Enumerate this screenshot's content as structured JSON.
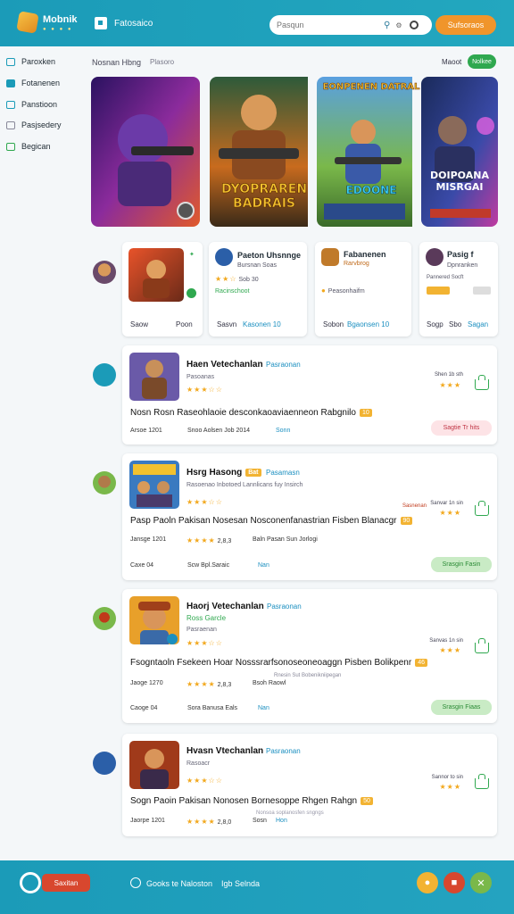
{
  "header": {
    "brand": "Mobnik",
    "brand_dots": "● ● ● ●",
    "section_label": "Fatosaico",
    "search_placeholder": "Pasqun",
    "cta_label": "Sufsoraos"
  },
  "sidebar": {
    "items": [
      {
        "label": "Paroxken"
      },
      {
        "label": "Fotanenen"
      },
      {
        "label": "Panstioon"
      },
      {
        "label": "Pasjsedery"
      },
      {
        "label": "Begican"
      }
    ]
  },
  "featured_section": {
    "title": "Nosnan Hbng",
    "subtitle": "Plasoro",
    "see_all": "Maoot",
    "pill": "Nolkee"
  },
  "banners": [
    {
      "title": "",
      "colors": [
        "#3a1a6e",
        "#c43a9e"
      ]
    },
    {
      "title": "DYOPRAREN BADRAIS",
      "colors": [
        "#1e3a2c",
        "#d97a1e"
      ]
    },
    {
      "title": "EONPENEN DATRAL",
      "subtitle": "EDOONE",
      "colors": [
        "#3b6bb5",
        "#6fb04a"
      ]
    },
    {
      "title": "DOIPOANA MISRGAI",
      "colors": [
        "#2a2f6e",
        "#b53ca0"
      ]
    }
  ],
  "featured_cards": [
    {
      "title": "",
      "footer_left": "Saow",
      "footer_right": "Poon"
    },
    {
      "title": "Paeton Uhsnnge",
      "sub": "Bursnan Soas",
      "rating_text": "Sob 30",
      "tag": "Racinschoot",
      "footer_left": "Sasvn",
      "footer_right": "Kasonen 10"
    },
    {
      "title": "Fabanenen",
      "sub": "Rarvbrog",
      "rating_text": "Peasonhaifm",
      "footer_left": "Sobon",
      "footer_right": "Bgaonsen 10"
    },
    {
      "title": "Pasig f",
      "sub": "Dpnranken",
      "rating_text": "Pannered Socft",
      "footer_left": "Sogp",
      "footer_mid": "Sbo",
      "footer_right": "Sagan"
    }
  ],
  "list_items": [
    {
      "title": "Haen Vetechanlan",
      "tag": "Pasraonan",
      "sub": "Pasoanas",
      "desc": "Nosn Rosn Raseohlaoie desconkaoaviaenneon Rabgnilo",
      "badge": "10",
      "meta_left": "Arsoe 1201",
      "meta_mid": "Snoo Aolsen Job 2014",
      "link": "Sonn",
      "right_label": "Shen 1b sth",
      "button": "Sagtie Tr hits",
      "button_style": "pink"
    },
    {
      "title": "Hsrg Hasong",
      "title_badge": "Bat",
      "tag": "Pasamasn",
      "sub": "Rasoenao Inbotoed Lannlicans fuy Insirch",
      "desc": "Pasp Paoln Pakisan Nosesan Nosconenfanastrian Fisben Blanacgr",
      "badge": "90",
      "meta_left": "Jansge 1201",
      "meta_mid": "2,8,3",
      "meta_extra": "Baln Pasan Sun Jorlogi",
      "foot_left": "Caxe 04",
      "foot_mid": "Scw Bpl.Saraic",
      "link": "Nan",
      "right_tag": "Sasnenan",
      "right_label": "Sanvar 1n sin",
      "button": "Srasgin Fasin",
      "button_style": "green"
    },
    {
      "title": "Haorj Vetechanlan",
      "tag": "Pasraonan",
      "sub": "Ross Garcle",
      "sub2": "Pasraenan",
      "desc": "Fsogntaoln Fsekeen Hoar Nosssrarfsonoseoneoaggn Pisben Bolikpenr",
      "badge": "46",
      "meta_left": "Jaoge 1270",
      "meta_mid": "2,8,3",
      "meta_extra": "Bsoh Raowl",
      "meta_extra2": "Rnesin Sut Bobenikniipegan",
      "foot_left": "Caoge 04",
      "foot_mid": "Sora Banusa Eals",
      "link": "Nan",
      "right_label": "Sanvas 1n sin",
      "button": "Srasgin Fiaas",
      "button_style": "green"
    },
    {
      "title": "Hvasn Vtechanlan",
      "tag": "Pasraonan",
      "sub": "Rasoacr",
      "desc": "Sogn Paoin Pakisan Nonosen Bornesoppe Rhgen Rahgn",
      "badge": "50",
      "meta_left": "Jaorpe 1201",
      "meta_mid": "2,8,0",
      "meta_extra": "Sosn",
      "meta_extra2": "Nonsoa soplanosfen sngngs",
      "link": "Hon",
      "right_label": "Sannor to sin",
      "button": "",
      "button_style": "none"
    }
  ],
  "footer": {
    "button": "Saxitan",
    "link_1": "Gooks te Naloston",
    "link_2": "Igb Selnda"
  },
  "colors": {
    "primary": "#1b9bb8",
    "accent": "#f0952b",
    "green": "#2fa84f",
    "star": "#f2a81d"
  }
}
